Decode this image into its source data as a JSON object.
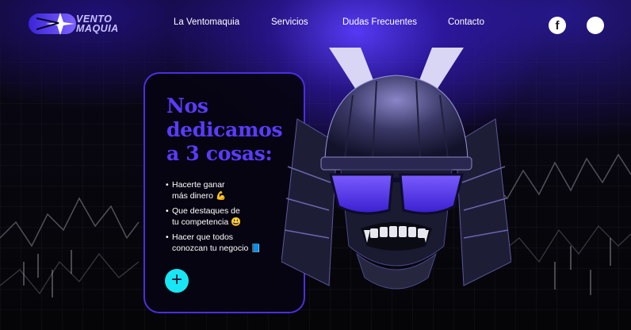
{
  "brand": {
    "name_line1": "VENTO",
    "name_line2": "MAQUIA",
    "accent": "#5a3bff",
    "cyan": "#19e6f4"
  },
  "nav": {
    "items": [
      {
        "label": "La Ventomaquia"
      },
      {
        "label": "Servicios"
      },
      {
        "label": "Dudas Frecuentes"
      },
      {
        "label": "Contacto"
      }
    ]
  },
  "social": {
    "facebook_glyph": "f",
    "icons": [
      "facebook-icon",
      "circle-social-icon"
    ]
  },
  "hero": {
    "title": "Nos\ndedicamos\na 3 cosas:",
    "items": [
      {
        "text": "Hacerte ganar\nmás dinero",
        "emoji": "💪"
      },
      {
        "text": "Que destaques de\ntu competencia",
        "emoji": "😃"
      },
      {
        "text": "Hacer que todos\nconozcan tu negocio",
        "emoji": "📘"
      }
    ],
    "plus_label": "+"
  }
}
